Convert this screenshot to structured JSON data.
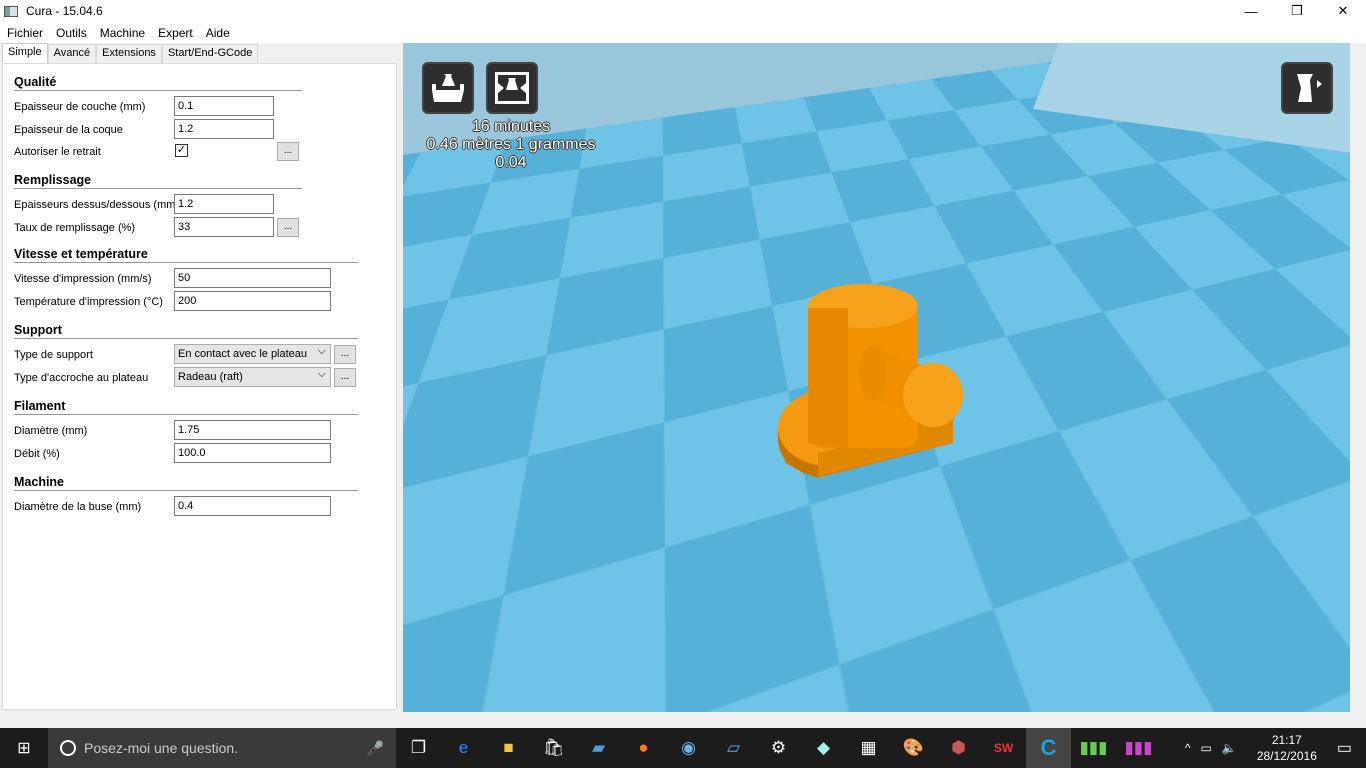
{
  "window": {
    "title": "Cura - 15.04.6",
    "minimize": "—",
    "maximize": "❐",
    "close": "✕"
  },
  "menu": [
    "Fichier",
    "Outils",
    "Machine",
    "Expert",
    "Aide"
  ],
  "tabs": [
    "Simple",
    "Avancé",
    "Extensions",
    "Start/End-GCode"
  ],
  "sections": {
    "qualite": {
      "title": "Qualité",
      "layer_label": "Epaisseur de couche (mm)",
      "layer_value": "0.1",
      "shell_label": "Epaisseur de la coque",
      "shell_value": "1.2",
      "retract_label": "Autoriser le retrait",
      "retract_checked": true
    },
    "remplissage": {
      "title": "Remplissage",
      "topbottom_label": "Epaisseurs dessus/dessous (mm)",
      "topbottom_value": "1.2",
      "density_label": "Taux de remplissage (%)",
      "density_value": "33"
    },
    "vitesse": {
      "title": "Vitesse et température",
      "speed_label": "Vitesse d'impression (mm/s)",
      "speed_value": "50",
      "temp_label": "Température d'impression (°C)",
      "temp_value": "200"
    },
    "support": {
      "title": "Support",
      "type_label": "Type de support",
      "type_value": "En contact avec le plateau",
      "adhesion_label": "Type d'accroche au plateau",
      "adhesion_value": "Radeau (raft)"
    },
    "filament": {
      "title": "Filament",
      "diameter_label": "Diamètre (mm)",
      "diameter_value": "1.75",
      "flow_label": "Débit (%)",
      "flow_value": "100.0"
    },
    "machine": {
      "title": "Machine",
      "nozzle_label": "Diamètre de la buse (mm)",
      "nozzle_value": "0.4"
    }
  },
  "dots_label": "...",
  "viewport": {
    "print_time": "16 minutes",
    "material": "0.46 mètres 1 grammes",
    "cost": "0.04",
    "model_color": "#f39200"
  },
  "taskbar": {
    "search_placeholder": "Posez-moi une question.",
    "time": "21:17",
    "date": "28/12/2016"
  }
}
